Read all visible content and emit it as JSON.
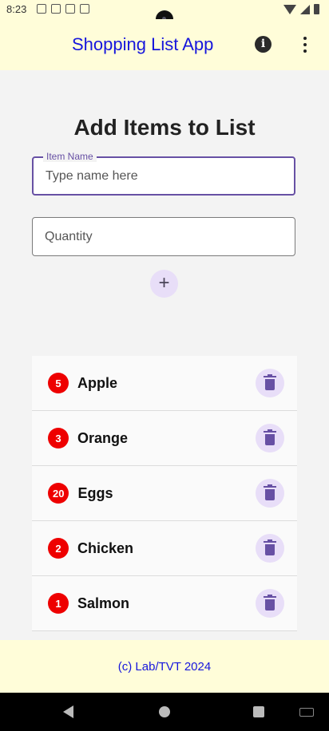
{
  "status_bar": {
    "time": "8:23",
    "icons_left": [
      "photo-icon",
      "letter-a-icon",
      "storage-icon",
      "sync-icon"
    ],
    "icons_right": [
      "wifi-icon",
      "signal-icon",
      "battery-icon"
    ]
  },
  "app_bar": {
    "title": "Shopping List App",
    "info_icon": "i",
    "actions": [
      "info-icon",
      "more-vert-icon"
    ]
  },
  "form": {
    "heading": "Add Items to List",
    "item_name": {
      "label": "Item Name",
      "placeholder": "Type name here",
      "value": ""
    },
    "quantity": {
      "placeholder": "Quantity",
      "value": ""
    },
    "add_icon": "+"
  },
  "items": [
    {
      "quantity": "5",
      "name": "Apple"
    },
    {
      "quantity": "3",
      "name": "Orange"
    },
    {
      "quantity": "20",
      "name": "Eggs"
    },
    {
      "quantity": "2",
      "name": "Chicken"
    },
    {
      "quantity": "1",
      "name": "Salmon"
    }
  ],
  "footer": {
    "text": "(c) Lab/TVT 2024"
  },
  "colors": {
    "bar_background": "#fffdd9",
    "title_blue": "#1616dc",
    "accent_purple": "#6750a4",
    "button_tint": "#e8def8",
    "badge_red": "#ee0000",
    "page_background": "#f3f3f3"
  }
}
